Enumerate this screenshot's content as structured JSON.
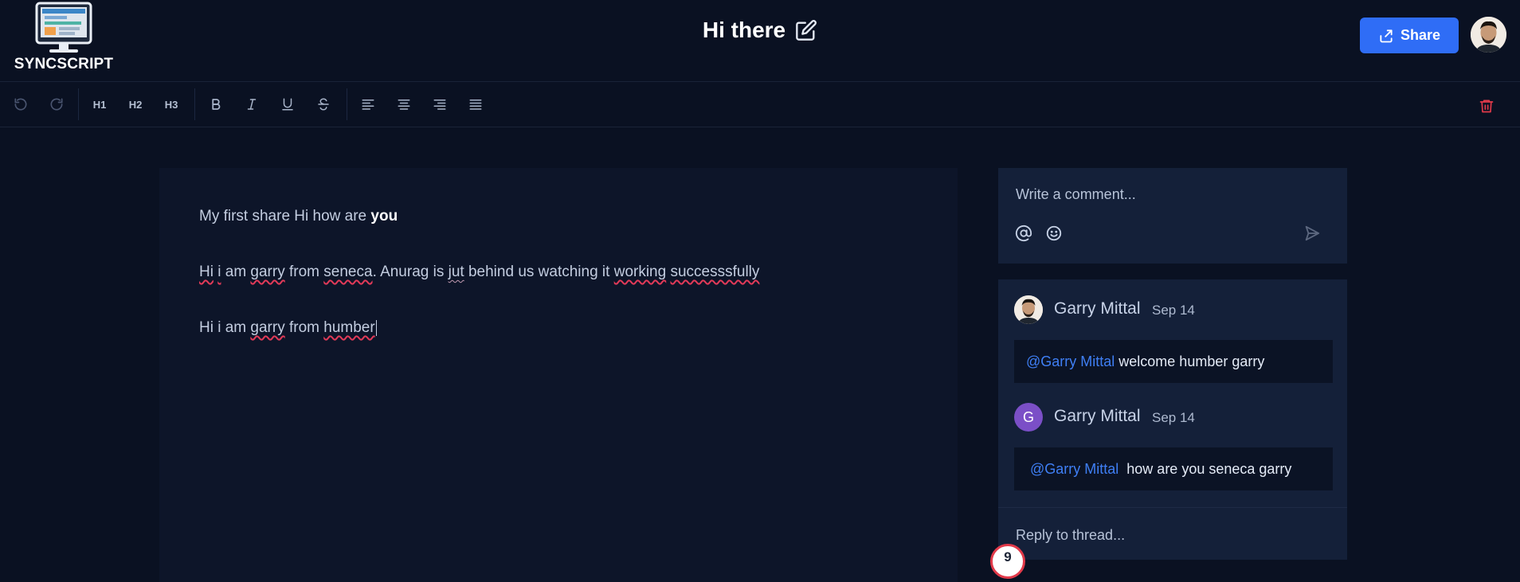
{
  "app": {
    "logo_text": "SYNCSCRIPT"
  },
  "header": {
    "doc_title": "Hi there",
    "share_label": "Share"
  },
  "toolbar": {
    "undo": "undo-icon",
    "redo": "redo-icon",
    "h1": "H1",
    "h2": "H2",
    "h3": "H3"
  },
  "editor": {
    "line1": {
      "normal": "My first share Hi how are ",
      "bold": "you"
    },
    "line2": {
      "w1": "Hi",
      "t1": " ",
      "w2": "i",
      "t2": " am ",
      "w3": "garry",
      "t3": " from ",
      "w4": "seneca",
      "t4": ". Anurag is ",
      "w5": "jut",
      "t5": " behind us watching it ",
      "w6": "working",
      "t6": " ",
      "w7": "successsfully"
    },
    "line3": {
      "t1": "Hi i am ",
      "w1": "garry",
      "t2": " from ",
      "w2": "humber"
    }
  },
  "comment_box": {
    "placeholder": "Write a comment..."
  },
  "thread": {
    "comments": [
      {
        "author": "Garry Mittal",
        "date": "Sep 14",
        "mention": "@Garry Mittal",
        "text": " welcome humber garry"
      },
      {
        "author": "Garry Mittal",
        "date": "Sep 14",
        "avatar_initial": "G",
        "mention": "@Garry Mittal",
        "text": "  how are you seneca garry"
      }
    ],
    "reply_placeholder": "Reply to thread..."
  },
  "badge": {
    "count": "9"
  },
  "colors": {
    "accent": "#2f6df6",
    "mention": "#3f7ff5",
    "danger": "#e23a4a",
    "background": "#0a1122",
    "panel": "#142039"
  }
}
